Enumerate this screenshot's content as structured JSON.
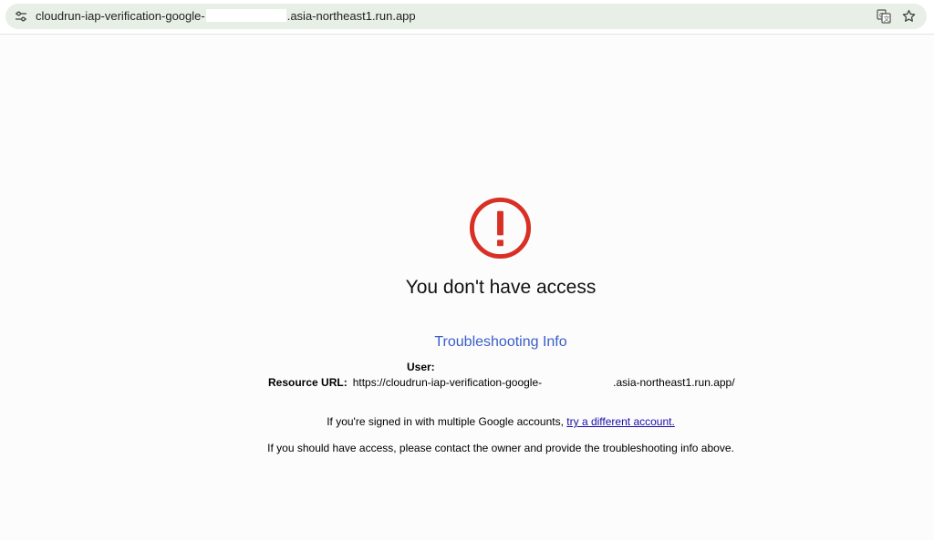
{
  "browser": {
    "url_prefix": "cloudrun-iap-verification-google-",
    "url_suffix": ".asia-northeast1.run.app",
    "icons": {
      "site_info": "tune-icon",
      "translate": "translate-icon",
      "bookmark": "star-icon"
    }
  },
  "page": {
    "icon": "alert-circle-icon",
    "icon_color": "#d93025",
    "heading": "You don't have access",
    "troubleshooting_title": "Troubleshooting Info",
    "user_label": "User:",
    "user_value": "",
    "resource_label": "Resource URL:",
    "resource_prefix": "https://cloudrun-iap-verification-google-",
    "resource_suffix": ".asia-northeast1.run.app/",
    "multi_account_text": "If you're signed in with multiple Google accounts, ",
    "multi_account_link": "try a different account.",
    "contact_text": "If you should have access, please contact the owner and provide the troubleshooting info above."
  },
  "colors": {
    "link_blue": "#3a5dc9",
    "anchor": "#1a0dab",
    "omnibox_bg": "#e8efe6"
  }
}
